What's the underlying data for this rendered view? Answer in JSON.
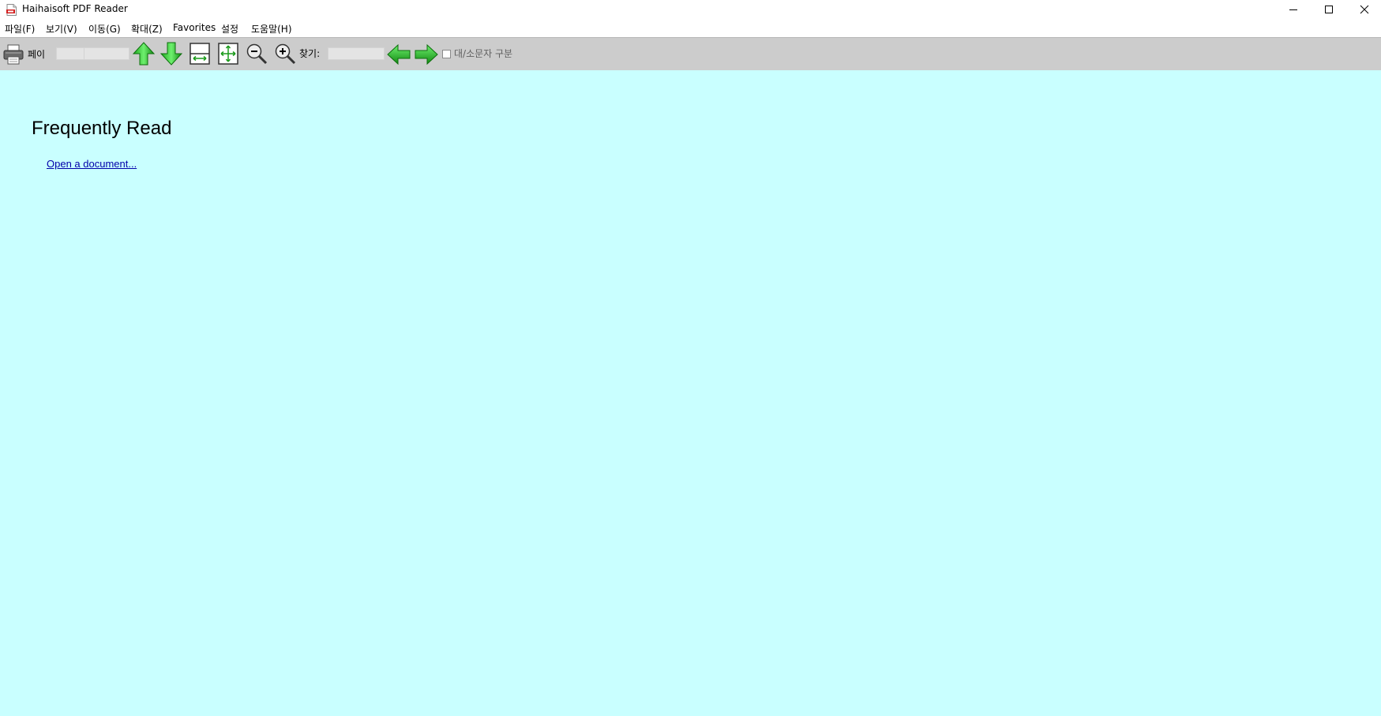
{
  "window": {
    "title": "Haihaisoft PDF Reader",
    "app_icon": "pdf-file-icon",
    "controls": [
      "minimize-icon",
      "maximize-icon",
      "close-icon"
    ]
  },
  "menu": {
    "items": [
      {
        "label": "파일(F)"
      },
      {
        "label": "보기(V)"
      },
      {
        "label": "이동(G)"
      },
      {
        "label": "확대(Z)"
      },
      {
        "label": "Favorites"
      },
      {
        "label": "설정"
      },
      {
        "label": "도움말(H)"
      }
    ]
  },
  "toolbar": {
    "print_icon": "printer-icon",
    "page_label": "페이",
    "page_value": "",
    "page_total": "",
    "prev_page_icon": "arrow-up-icon",
    "next_page_icon": "arrow-down-icon",
    "fit_width_icon": "fit-width-icon",
    "fit_page_icon": "fit-page-icon",
    "zoom_out_icon": "zoom-out-icon",
    "zoom_in_icon": "zoom-in-icon",
    "find_label": "찾기:",
    "find_value": "",
    "find_prev_icon": "arrow-left-icon",
    "find_next_icon": "arrow-right-icon",
    "match_case_label": "대/소문자 구분",
    "match_case_checked": false
  },
  "content": {
    "background": "#c9ffff",
    "heading": "Frequently Read",
    "open_link": "Open a document..."
  }
}
